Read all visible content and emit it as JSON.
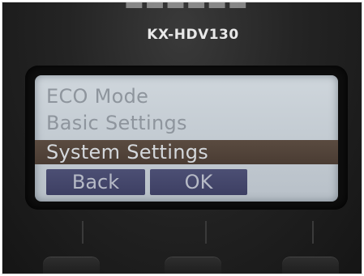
{
  "device": {
    "model": "KX-HDV130"
  },
  "screen": {
    "menu_items": [
      {
        "label": "ECO Mode",
        "selected": false
      },
      {
        "label": "Basic Settings",
        "selected": false
      },
      {
        "label": "System Settings",
        "selected": true
      }
    ],
    "softkeys": {
      "back_label": "Back",
      "ok_label": "OK"
    }
  },
  "colors": {
    "lcd_background": "#c5cdd4",
    "menu_text": "#8e959d",
    "highlight_bar": "#4f4137",
    "softkey_background": "#45476b"
  }
}
